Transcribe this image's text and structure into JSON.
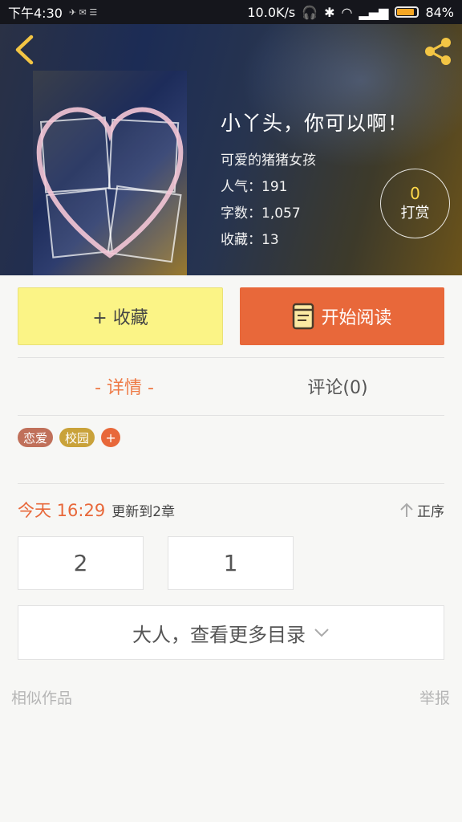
{
  "status_bar": {
    "time": "下午4:30",
    "network_speed": "10.0K/s",
    "battery_percent": "84%",
    "battery_level": 0.84
  },
  "book": {
    "title": "小丫头，你可以啊！",
    "author": "可爱的猪猪女孩",
    "popularity": "人气：191",
    "word_count": "字数：1,057",
    "favorites": "收藏：13",
    "tip_count": "0",
    "tip_label": "打赏"
  },
  "actions": {
    "collect_label": "+ 收藏",
    "read_label": "开始阅读"
  },
  "tabs": [
    {
      "label": "- 详情 -",
      "active": true
    },
    {
      "label": "评论(0)",
      "active": false
    }
  ],
  "tags": [
    {
      "label": "恋爱",
      "color": "#c0705a"
    },
    {
      "label": "校园",
      "color": "#c9a23a"
    }
  ],
  "tag_add_label": "+",
  "update": {
    "time": "今天 16:29",
    "text": "更新到2章",
    "sort_label": "正序"
  },
  "chapters": [
    "2",
    "1"
  ],
  "more_catalog_label": "大人，查看更多目录",
  "similar_label": "相似作品",
  "report_label": "举报",
  "colors": {
    "accent": "#e8683a",
    "collect_bg": "#fbf486",
    "tip_count": "#ffd84a"
  }
}
